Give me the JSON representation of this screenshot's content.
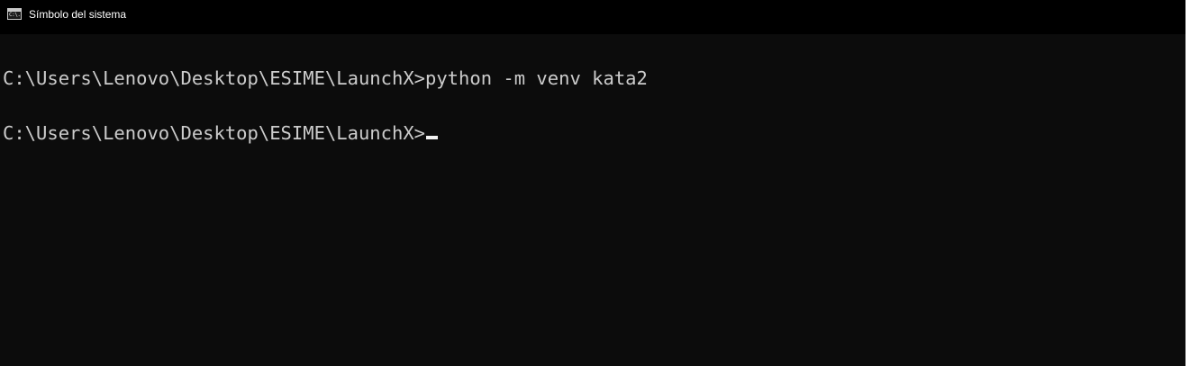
{
  "window": {
    "title": "Símbolo del sistema",
    "icon": "cmd-icon",
    "icon_glyph": "C:\\."
  },
  "console": {
    "lines": [
      {
        "prompt": "C:\\Users\\Lenovo\\Desktop\\ESIME\\LaunchX>",
        "command": "python -m venv kata2"
      },
      {
        "prompt": "C:\\Users\\Lenovo\\Desktop\\ESIME\\LaunchX>",
        "command": ""
      }
    ]
  },
  "colors": {
    "background": "#0c0c0c",
    "titlebar": "#000000",
    "text": "#cccccc",
    "cursor": "#f2f2f2"
  }
}
